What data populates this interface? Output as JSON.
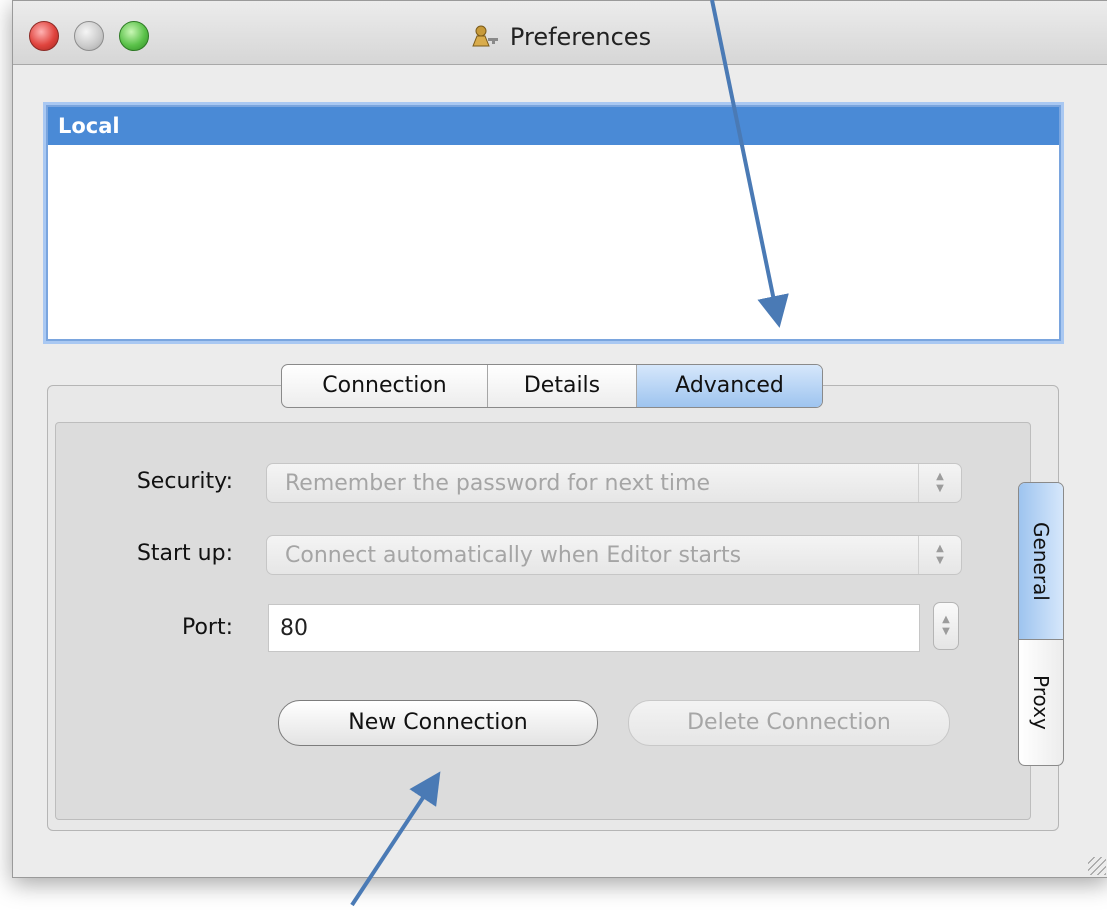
{
  "window": {
    "title": "Preferences"
  },
  "connections_list": {
    "items": [
      "Local"
    ],
    "selected_index": 0
  },
  "tabs": {
    "items": [
      {
        "label": "Connection",
        "active": false
      },
      {
        "label": "Details",
        "active": false
      },
      {
        "label": "Advanced",
        "active": true
      }
    ]
  },
  "form": {
    "security_label": "Security:",
    "security_value": "Remember the password for next time",
    "startup_label": "Start up:",
    "startup_value": "Connect automatically when Editor starts",
    "port_label": "Port:",
    "port_value": "80"
  },
  "buttons": {
    "new_connection": "New Connection",
    "delete_connection": "Delete Connection"
  },
  "side_tabs": {
    "items": [
      {
        "label": "General",
        "active": true
      },
      {
        "label": "Proxy",
        "active": false
      }
    ]
  },
  "colors": {
    "selection": "#4a8ad6",
    "active_tab": "#9ec4ef",
    "annotation_arrow": "#4a7ab5"
  },
  "icons": {
    "app_icon": "keys-person-icon",
    "stepper": "up-down-chevron-icon",
    "annotation": "callout-arrow"
  }
}
